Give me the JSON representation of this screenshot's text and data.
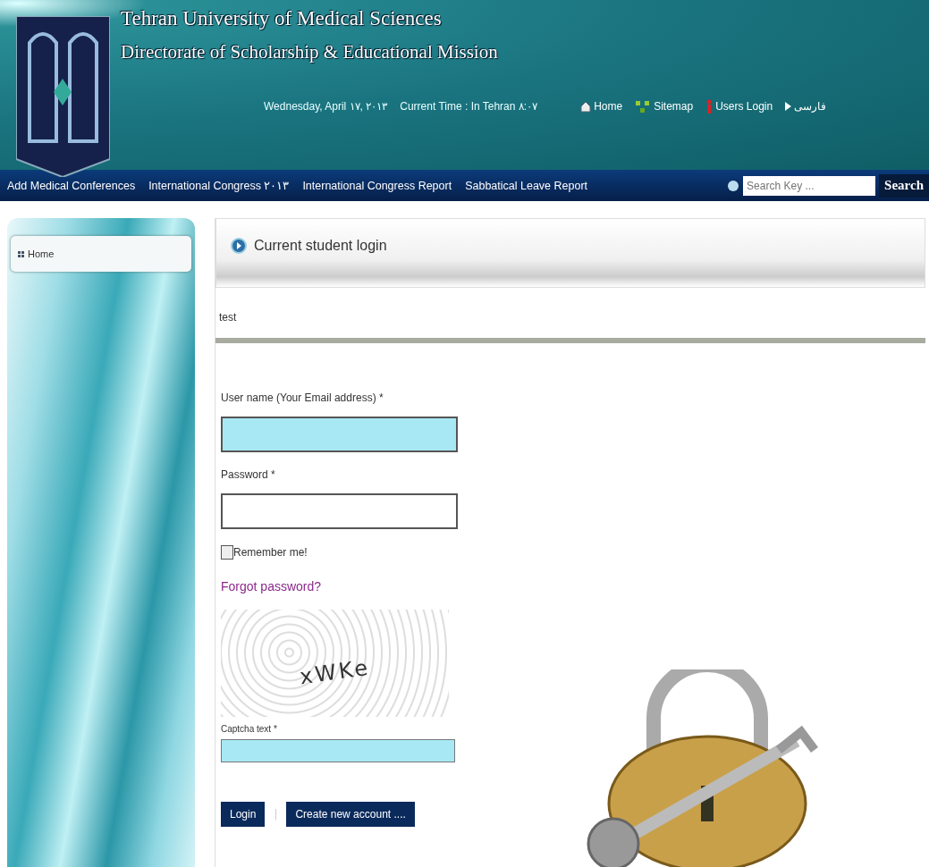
{
  "header": {
    "title": "Tehran University of Medical Sciences",
    "subtitle": "Directorate of Scholarship & Educational Mission",
    "date": "Wednesday, April ۱۷, ۲۰۱۳",
    "time": "Current Time : In Tehran ۸:۰۷",
    "links": [
      {
        "kind": "home",
        "label": "Home"
      },
      {
        "kind": "sitemap",
        "label": "Sitemap"
      },
      {
        "kind": "login",
        "label": "Users Login"
      },
      {
        "kind": "language",
        "label": "فارسی"
      }
    ]
  },
  "nav": {
    "items": [
      "Add Medical Conferences",
      "International Congress ۲۰۱۳",
      "International Congress Report",
      "Sabbatical Leave Report"
    ],
    "search": {
      "placeholder": "Search Key ...",
      "button": "Search"
    }
  },
  "sidebar": {
    "items": [
      {
        "label": "Home",
        "selected": true
      }
    ]
  },
  "panel": {
    "title": "Current student login",
    "intro": "test",
    "fields": [
      {
        "label": "User name (Your Email address) *",
        "highlighted": true
      },
      {
        "label": "Password *",
        "highlighted": false
      }
    ],
    "remember": {
      "label": "Remember me!",
      "checked": false
    },
    "forgot": "Forgot password?",
    "captcha": {
      "image_text": "xWKe",
      "label": "Captcha text *",
      "highlighted": true
    },
    "buttons": [
      "Login",
      "Create new account ...."
    ],
    "separator": "|"
  }
}
